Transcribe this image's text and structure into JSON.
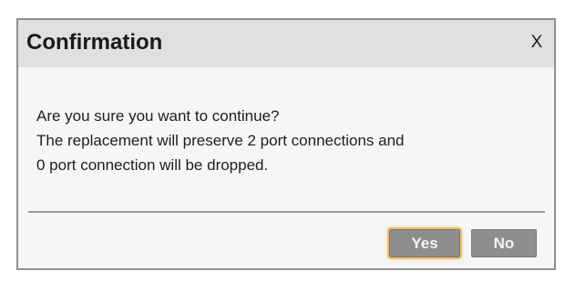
{
  "dialog": {
    "title": "Confirmation",
    "close_label": "X",
    "message_lines": [
      "Are you sure you want to continue?",
      "The replacement will preserve 2 port connections and",
      "0 port connection will be dropped."
    ],
    "buttons": {
      "yes_label": "Yes",
      "no_label": "No"
    }
  },
  "colors": {
    "titlebar_bg": "#e0e0e0",
    "dialog_bg": "#f6f6f6",
    "button_bg": "#8e8e8e",
    "focus_outline": "#f0bf5e"
  }
}
